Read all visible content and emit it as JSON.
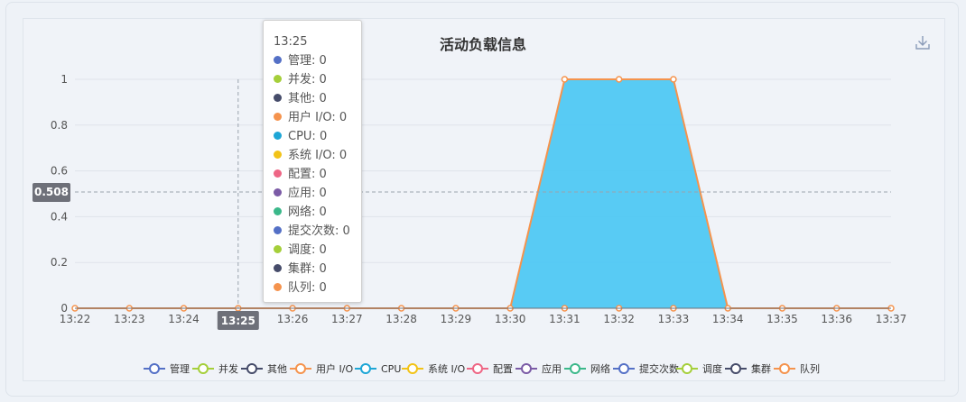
{
  "chart_data": {
    "type": "area",
    "title": "活动负载信息",
    "x": [
      "13:22",
      "13:23",
      "13:24",
      "13:25",
      "13:26",
      "13:27",
      "13:28",
      "13:29",
      "13:30",
      "13:31",
      "13:32",
      "13:33",
      "13:34",
      "13:35",
      "13:36",
      "13:37"
    ],
    "ylim": [
      0,
      1
    ],
    "y_ticks": [
      "0",
      "0.2",
      "0.4",
      "0.6",
      "0.8",
      "1"
    ],
    "filled_values": [
      0,
      0,
      0,
      0,
      0,
      0,
      0,
      0,
      0,
      1,
      1,
      1,
      0,
      0,
      0,
      0
    ],
    "line_values": [
      0,
      0,
      0,
      0,
      0,
      0,
      0,
      0,
      0,
      1,
      1,
      1,
      0,
      0,
      0,
      0
    ],
    "series": [
      {
        "name": "管理",
        "color": "#5470c6"
      },
      {
        "name": "并发",
        "color": "#a5cf3a"
      },
      {
        "name": "其他",
        "color": "#464c6a"
      },
      {
        "name": "用户 I/O",
        "color": "#f5934d"
      },
      {
        "name": "CPU",
        "color": "#1ea6d6"
      },
      {
        "name": "系统 I/O",
        "color": "#f2c318"
      },
      {
        "name": "配置",
        "color": "#ee6685"
      },
      {
        "name": "应用",
        "color": "#7b5ba6"
      },
      {
        "name": "网络",
        "color": "#3bb88a"
      },
      {
        "name": "提交次数",
        "color": "#5470c6"
      },
      {
        "name": "调度",
        "color": "#a5cf3a"
      },
      {
        "name": "集群",
        "color": "#464c6a"
      },
      {
        "name": "队列",
        "color": "#f5934d"
      }
    ],
    "area_color": "#4fc8f3",
    "line_color": "#f5934d",
    "grid": true,
    "legend_position": "bottom"
  },
  "tooltip": {
    "time": "13:25",
    "rows": [
      {
        "name": "管理",
        "value": "0",
        "color": "#5470c6"
      },
      {
        "name": "并发",
        "value": "0",
        "color": "#a5cf3a"
      },
      {
        "name": "其他",
        "value": "0",
        "color": "#464c6a"
      },
      {
        "name": "用户 I/O",
        "value": "0",
        "color": "#f5934d"
      },
      {
        "name": "CPU",
        "value": "0",
        "color": "#1ea6d6"
      },
      {
        "name": "系统 I/O",
        "value": "0",
        "color": "#f2c318"
      },
      {
        "name": "配置",
        "value": "0",
        "color": "#ee6685"
      },
      {
        "name": "应用",
        "value": "0",
        "color": "#7b5ba6"
      },
      {
        "name": "网络",
        "value": "0",
        "color": "#3bb88a"
      },
      {
        "name": "提交次数",
        "value": "0",
        "color": "#5470c6"
      },
      {
        "name": "调度",
        "value": "0",
        "color": "#a5cf3a"
      },
      {
        "name": "集群",
        "value": "0",
        "color": "#464c6a"
      },
      {
        "name": "队列",
        "value": "0",
        "color": "#f5934d"
      }
    ]
  },
  "crosshair": {
    "x_label": "13:25",
    "y_label": "0.508",
    "x_value": "13:25",
    "y_value": 0.508
  },
  "toolbar": {
    "download_icon": "download-icon"
  }
}
